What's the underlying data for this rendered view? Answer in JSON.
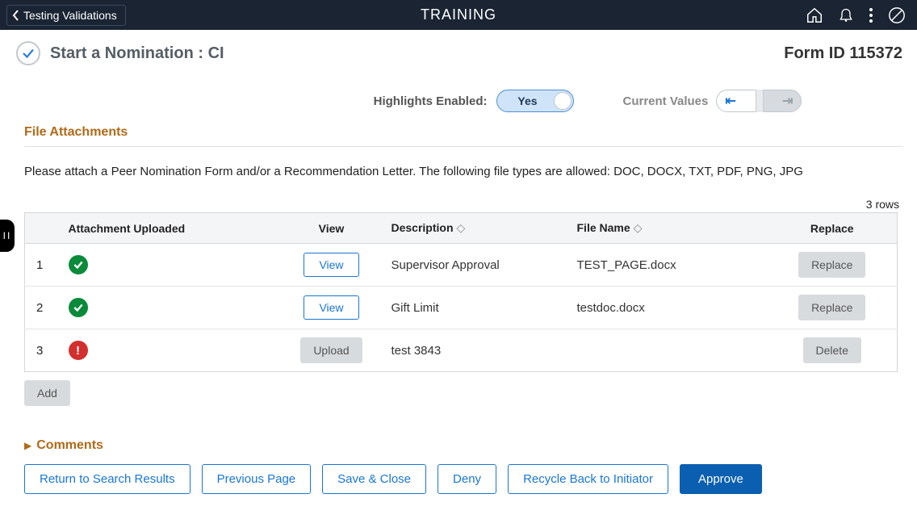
{
  "banner": {
    "back_label": "Testing Validations",
    "title": "TRAINING"
  },
  "page": {
    "title": "Start a Nomination :  CI",
    "form_id_label": "Form ID",
    "form_id_value": "115372"
  },
  "controls": {
    "highlights_label": "Highlights Enabled:",
    "highlights_value": "Yes",
    "current_values_label": "Current Values"
  },
  "attachments": {
    "section_title": "File Attachments",
    "instructions": "Please attach a Peer Nomination Form and/or a Recommendation Letter. The following file types are allowed: DOC, DOCX, TXT, PDF, PNG, JPG",
    "row_count_label": "3 rows",
    "headers": {
      "attached": "Attachment Uploaded",
      "view": "View",
      "description": "Description",
      "file_name": "File Name",
      "replace": "Replace"
    },
    "rows": [
      {
        "num": "1",
        "status": "ok",
        "view_label": "View",
        "description": "Supervisor Approval",
        "file_name": "TEST_PAGE.docx",
        "action_label": "Replace"
      },
      {
        "num": "2",
        "status": "ok",
        "view_label": "View",
        "description": "Gift Limit",
        "file_name": "testdoc.docx",
        "action_label": "Replace"
      },
      {
        "num": "3",
        "status": "err",
        "view_label": "Upload",
        "description": "test 3843",
        "file_name": "",
        "action_label": "Delete"
      }
    ],
    "add_label": "Add"
  },
  "comments": {
    "label": "Comments"
  },
  "buttons": {
    "return": "Return to Search Results",
    "previous": "Previous Page",
    "save_close": "Save & Close",
    "deny": "Deny",
    "recycle": "Recycle Back to Initiator",
    "approve": "Approve"
  }
}
